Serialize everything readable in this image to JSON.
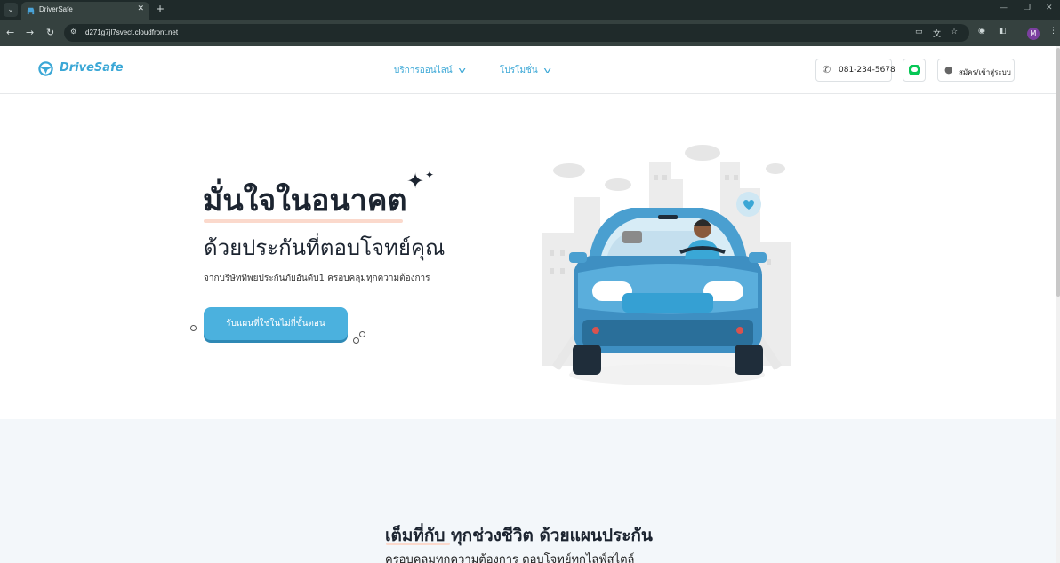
{
  "browser": {
    "tab_title": "DriverSafe",
    "url": "d271g7jl7svect.cloudfront.net",
    "profile_initial": "M"
  },
  "header": {
    "logo_text": "DriveSafe",
    "nav": [
      {
        "label": "บริการออนไลน์"
      },
      {
        "label": "โปรโมชั่น"
      }
    ],
    "phone": "081-234-5678",
    "login_label": "สมัคร/เข้าสู่ระบบ"
  },
  "hero": {
    "title": "มั่นใจในอนาคต",
    "subtitle": "ด้วยประกันที่ตอบโจทย์คุณ",
    "description": "จากบริษัททิพยประกันภัยอันดับ1 ครอบคลุมทุกความต้องการ",
    "cta_label": "รับแผนที่ใช่ในไม่กี่ขั้นตอน"
  },
  "section2": {
    "title": "เต็มที่กับ ทุกช่วงชีวิต ด้วยแผนประกัน",
    "subtitle": "ครอบคลุมทุกความต้องการ ตอบโจทย์ทุกไลฟ์สไตล์"
  },
  "colors": {
    "brand": "#3aa7d6",
    "cta": "#4bb1de",
    "accent_underline": "#fbd9cc",
    "line_green": "#06c755"
  },
  "icons": [
    "steering-wheel-icon",
    "chevron-down-icon",
    "phone-icon",
    "line-icon",
    "user-icon",
    "sparkle-icon"
  ]
}
